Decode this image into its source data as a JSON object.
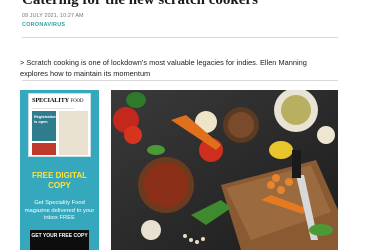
{
  "article": {
    "title": "Catering for the new scratch cookers",
    "date": "09 JULY 2021, 10:27 AM",
    "category": "CORONAVIRUS",
    "summary": "> Scratch cooking is one of lockdown’s most valuable legacies for indies. Ellen Manning explores how to maintain its momentum"
  },
  "ad": {
    "magazine_logo": "SPECIALITY",
    "magazine_logo_suffix": "FOOD",
    "magazine_cover_text": "Registration is open",
    "headline": "FREE DIGITAL COPY",
    "body": "Get Speciality Food magazine delivered to your inbox FREE",
    "button_label": "GET YOUR FREE COPY"
  },
  "colors": {
    "accent_teal": "#35a8bd",
    "category_teal": "#2aa0a8",
    "ad_headline_yellow": "#ffe23a"
  }
}
